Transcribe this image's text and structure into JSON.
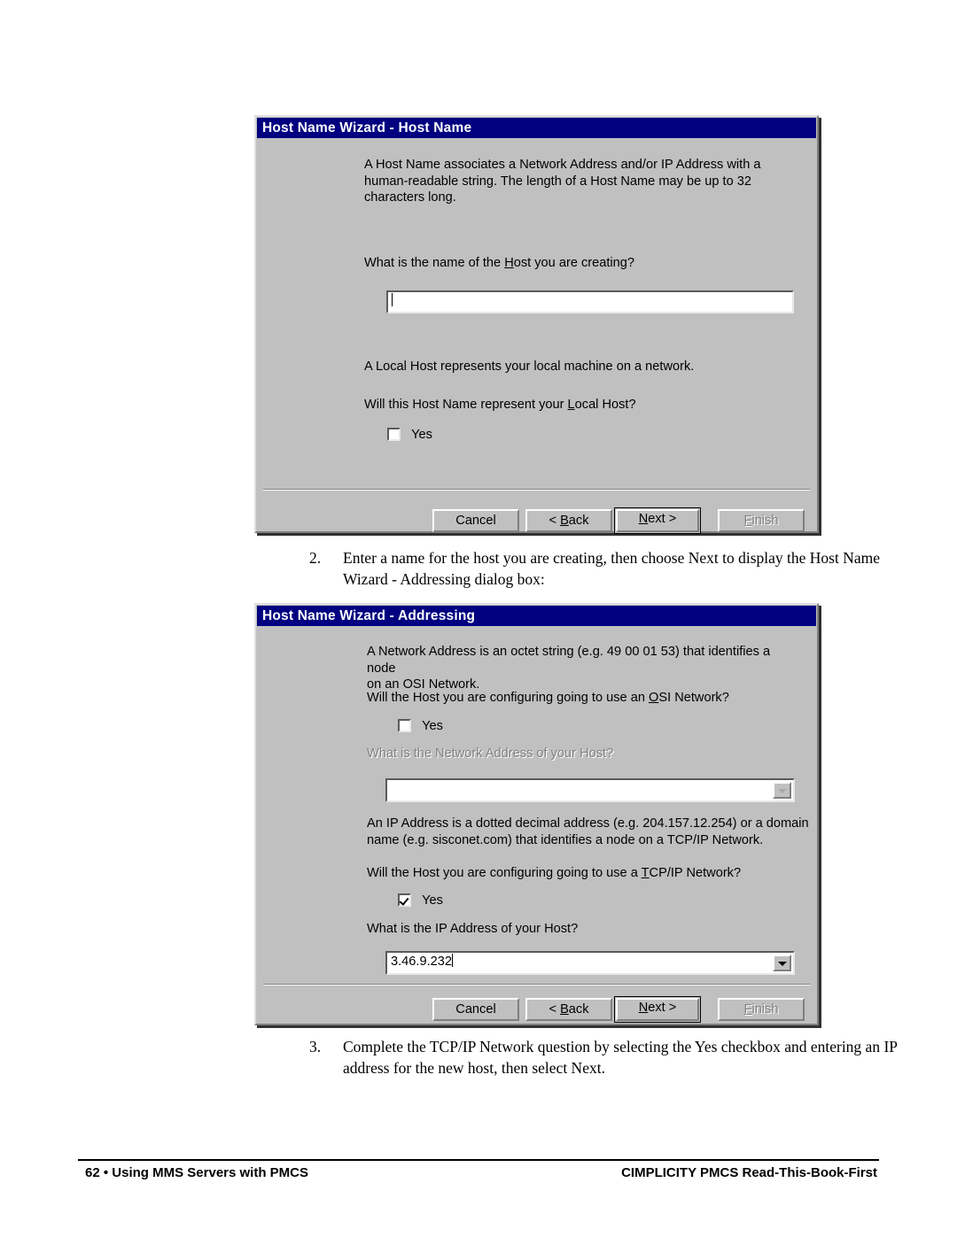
{
  "page": {
    "footer_page_number": "62",
    "footer_bullet": "•",
    "footer_left_text": "Using MMS Servers with PMCS",
    "footer_right_text": "CIMPLICITY PMCS Read-This-Book-First",
    "colors": {
      "titlebar_blue": "#000080",
      "dialog_face": "#c0c0c0",
      "disabled_text": "#808080",
      "field_white": "#ffffff"
    }
  },
  "dialog1": {
    "title": "Host Name Wizard - Host Name",
    "intro_text": "A Host Name associates a Network Address and/or IP Address with a\nhuman-readable string. The length of a Host Name may be up to 32\ncharacters long.",
    "host_question": "What is the name of the Host you are creating?",
    "host_name_value": "",
    "local_host_info": "A Local Host represents your local machine on a network.",
    "local_host_question": "Will this Host Name represent your Local Host?",
    "yes_label": "Yes",
    "yes_checked": false,
    "buttons": {
      "cancel": "Cancel",
      "back": "< Back",
      "next": "Next >",
      "finish": "Finish",
      "finish_enabled": false,
      "default_button": "Next >"
    }
  },
  "step2": {
    "number": "2.",
    "text": "Enter a name for the host you are creating, then choose Next to display the Host Name Wizard - Addressing dialog box:"
  },
  "dialog2": {
    "title": "Host Name Wizard - Addressing",
    "network_intro": "A Network Address is an octet string (e.g. 49 00 01 53) that identifies a node\non an OSI Network.",
    "osi_question": "Will the Host you are configuring going to use an OSI Network?",
    "osi_yes_label": "Yes",
    "osi_yes_checked": false,
    "network_address_question": "What is the Network Address of your Host?",
    "network_address_question_disabled": true,
    "network_address_value": "",
    "network_address_combo_disabled": true,
    "ip_intro": "An IP Address is a dotted decimal address (e.g. 204.157.12.254) or a domain\nname (e.g. sisconet.com) that identifies a node on a TCP/IP Network.",
    "tcpip_question": "Will the Host you are configuring going to use a TCP/IP Network?",
    "tcpip_yes_label": "Yes",
    "tcpip_yes_checked": true,
    "ip_address_question": "What is the IP Address of your Host?",
    "ip_address_value": "3.46.9.232",
    "buttons": {
      "cancel": "Cancel",
      "back": "< Back",
      "next": "Next >",
      "finish": "Finish",
      "finish_enabled": false,
      "default_button": "Next >"
    }
  },
  "step3": {
    "number": "3.",
    "text": "Complete the TCP/IP Network question by selecting the Yes checkbox and entering an IP address for the new host, then select Next."
  }
}
